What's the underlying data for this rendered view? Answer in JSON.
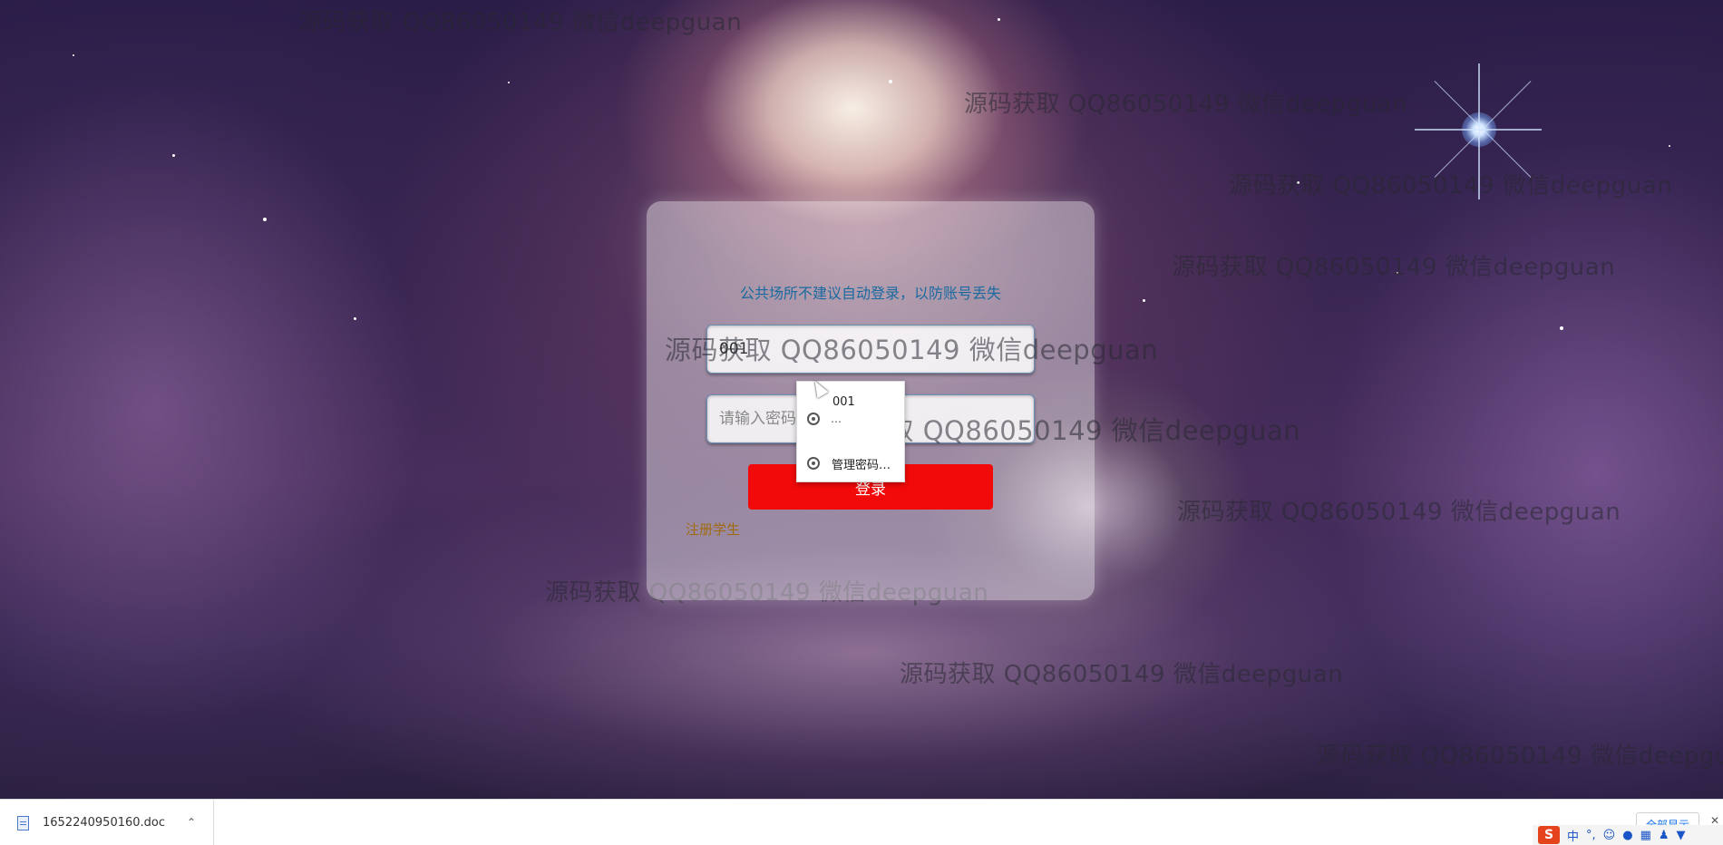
{
  "watermark": "源码获取 QQ86050149 微信deepguan",
  "login": {
    "notice": "公共场所不建议自动登录，以防账号丢失",
    "username_value": "001",
    "password_placeholder": "请输入密码",
    "login_label": "登录",
    "register_label": "注册学生"
  },
  "autofill": {
    "suggestion": "001",
    "masked": "…",
    "manage_label": "管理密码…"
  },
  "downloads": {
    "file_name": "1652240950160.doc",
    "show_all_label": "全部显示",
    "close_symbol": "✕"
  },
  "ime": {
    "logo": "S",
    "mode": "中"
  }
}
